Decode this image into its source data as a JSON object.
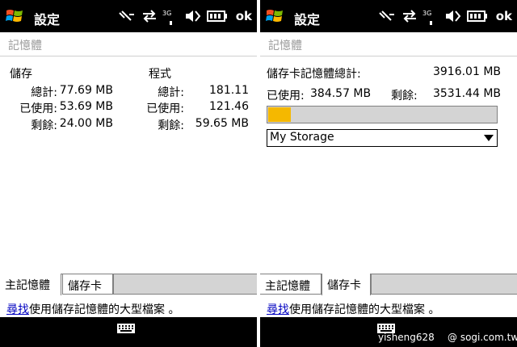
{
  "title_bar": {
    "title": "設定",
    "ok_label": "ok"
  },
  "section_title": "記憶體",
  "main_memory": {
    "storage": {
      "heading": "儲存",
      "total_label": "總計:",
      "total": "77.69 MB",
      "used_label": "已使用:",
      "used": "53.69 MB",
      "free_label": "剩餘:",
      "free": "24.00 MB"
    },
    "program": {
      "heading": "程式",
      "total_label": "總計:",
      "total": "181.11",
      "used_label": "已使用:",
      "used": "121.46",
      "free_label": "剩餘:",
      "free": "59.65 MB"
    }
  },
  "storage_card": {
    "total_label": "儲存卡記憶體總計:",
    "total": "3916.01 MB",
    "used_label": "已使用:",
    "used": "384.57 MB",
    "free_label": "剩餘:",
    "free": "3531.44 MB",
    "used_fraction": 0.0982,
    "selected_storage": "My Storage"
  },
  "tabs": [
    {
      "label": "主記憶體"
    },
    {
      "label": "儲存卡"
    }
  ],
  "footer": {
    "link_text": "尋找",
    "rest_text": "使用儲存記憶體的大型檔案 。"
  },
  "watermark": {
    "user": "yisheng628",
    "site": "@ sogi.com.tw"
  },
  "colors": {
    "titlebar": "#000000",
    "progress_fill": "#f5b800",
    "link": "#0000c0"
  }
}
